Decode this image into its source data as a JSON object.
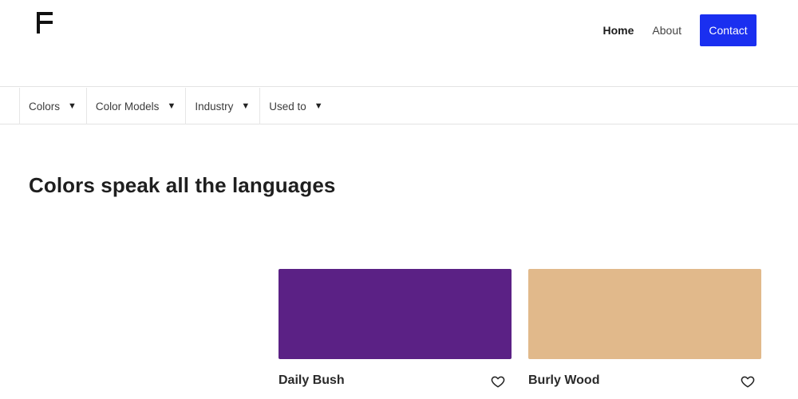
{
  "header": {
    "nav": {
      "home": "Home",
      "about": "About",
      "contact": "Contact"
    }
  },
  "filters": [
    {
      "label": "Colors"
    },
    {
      "label": "Color Models"
    },
    {
      "label": "Industry"
    },
    {
      "label": "Used to"
    }
  ],
  "main": {
    "headline": "Colors speak all the languages",
    "cards": [
      {
        "name": "Daily Bush",
        "color": "#5b2185",
        "favorite_icon": "heart-outline-icon"
      },
      {
        "name": "Burly Wood",
        "color": "#e1b98b",
        "favorite_icon": "heart-outline-icon"
      }
    ]
  },
  "colors": {
    "accent": "#1a2ff0"
  }
}
